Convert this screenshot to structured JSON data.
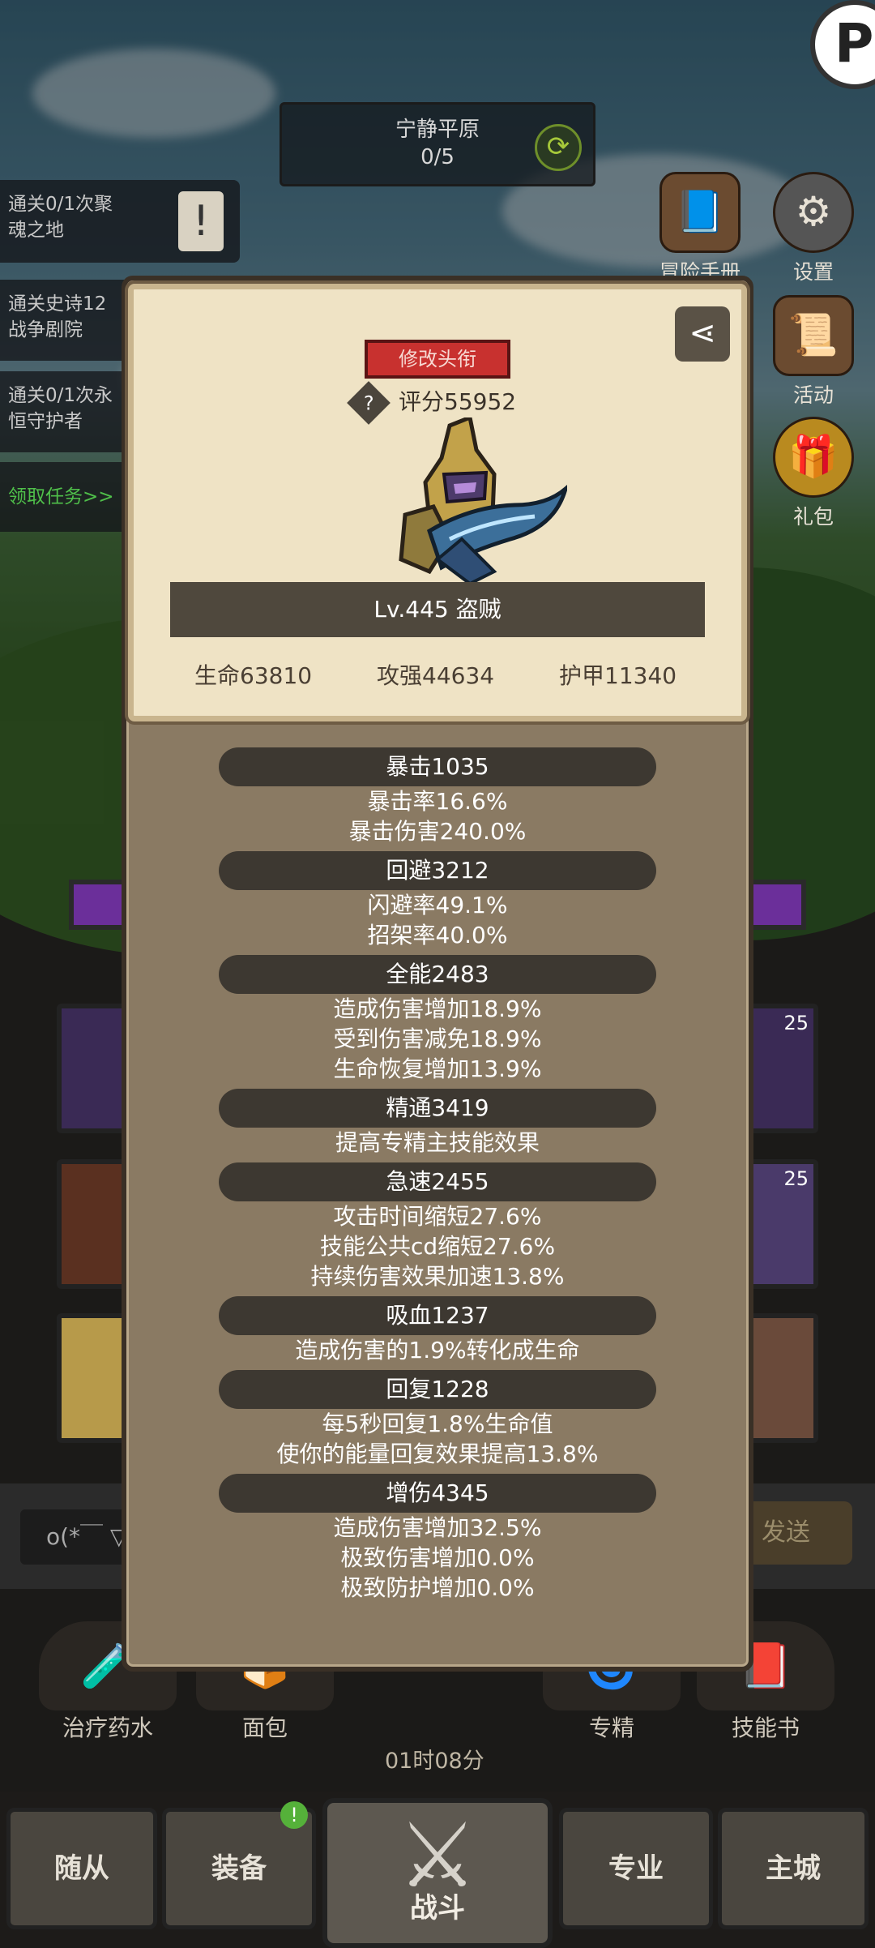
{
  "stage": {
    "name": "宁静平原",
    "progress": "0/5"
  },
  "quests": [
    {
      "line1": "通关0/1次聚",
      "line2": "魂之地"
    },
    {
      "line1": "通关史诗12",
      "line2": "战争剧院"
    },
    {
      "line1": "通关0/1次永",
      "line2": "恒守护者"
    }
  ],
  "quest_link": "领取任务>>",
  "side_menu": {
    "adventure": "冒险手册",
    "settings": "设置",
    "activity": "活动",
    "gift": "礼包"
  },
  "panel": {
    "title_button": "修改头衔",
    "score": "评分55952",
    "level_class": "Lv.445 盗贼",
    "attributes": {
      "hp": "生命63810",
      "attack": "攻强44634",
      "armor": "护甲11340"
    },
    "stats": [
      {
        "header": "暴击1035",
        "lines": [
          "暴击率16.6%",
          "暴击伤害240.0%"
        ]
      },
      {
        "header": "回避3212",
        "lines": [
          "闪避率49.1%",
          "招架率40.0%"
        ]
      },
      {
        "header": "全能2483",
        "lines": [
          "造成伤害增加18.9%",
          "受到伤害减免18.9%",
          "生命恢复增加13.9%"
        ]
      },
      {
        "header": "精通3419",
        "lines": [
          "提高专精主技能效果"
        ]
      },
      {
        "header": "急速2455",
        "lines": [
          "攻击时间缩短27.6%",
          "技能公共cd缩短27.6%",
          "持续伤害效果加速13.8%"
        ]
      },
      {
        "header": "吸血1237",
        "lines": [
          "造成伤害的1.9%转化成生命"
        ]
      },
      {
        "header": "回复1228",
        "lines": [
          "每5秒回复1.8%生命值",
          "使你的能量回复效果提高13.8%"
        ]
      },
      {
        "header": "增伤4345",
        "lines": [
          "造成伤害增加32.5%",
          "极致伤害增加0.0%",
          "极致防护增加0.0%"
        ]
      }
    ]
  },
  "slot_counts": [
    "25",
    "25"
  ],
  "chat": {
    "input_text": "o(*￣ ▽",
    "send_label": "发送"
  },
  "items": {
    "potion": "治疗药水",
    "bread": "面包",
    "spec": "专精",
    "skillbook": "技能书"
  },
  "timer": "01时08分",
  "nav": {
    "followers": "随从",
    "equipment": "装备",
    "battle": "战斗",
    "profession": "专业",
    "city": "主城",
    "badge": "!"
  }
}
